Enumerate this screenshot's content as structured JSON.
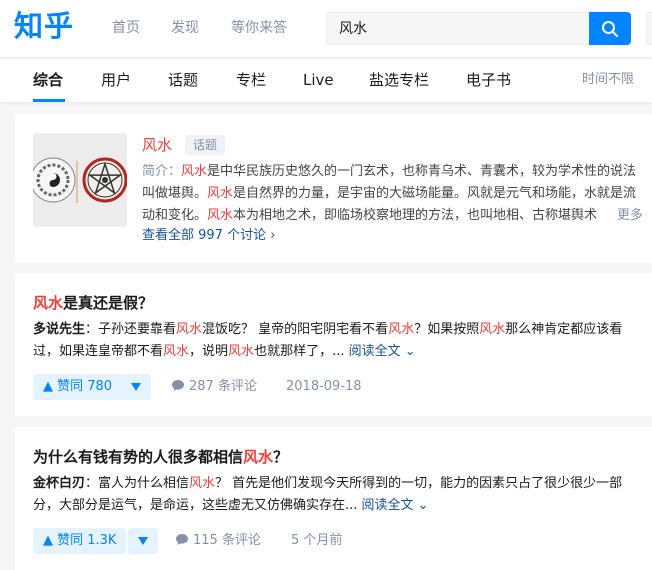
{
  "header": {
    "logo": "知乎",
    "nav": [
      "首页",
      "发现",
      "等你来答"
    ],
    "search": {
      "value": "风水"
    }
  },
  "tabs": {
    "items": [
      "综合",
      "用户",
      "话题",
      "专栏",
      "Live",
      "盐选专栏",
      "电子书"
    ],
    "active": "综合",
    "time_filter": "时间不限"
  },
  "topic_card": {
    "name": "风水",
    "badge": "话题",
    "desc_label": "简介：",
    "desc_parts": [
      {
        "t": "风水",
        "hl": true
      },
      {
        "t": "是中华民族历史悠久的一门玄术，也称青乌术、青囊术，较为学术性的说法叫做堪舆。",
        "hl": false
      },
      {
        "t": "风水",
        "hl": true
      },
      {
        "t": "是自然界的力量，是宇宙的大磁场能量。风就是元气和场能，水就是流动和变化。",
        "hl": false
      },
      {
        "t": "风水",
        "hl": true
      },
      {
        "t": "本为相地之术，即临场校察地理的方法，也叫地相、古称堪舆术",
        "hl": false
      }
    ],
    "more_label": "更多",
    "discuss_link": "查看全部 997 个讨论 ›"
  },
  "answers": [
    {
      "title_parts": [
        {
          "t": "风水",
          "hl": true
        },
        {
          "t": "是真还是假？",
          "hl": false
        }
      ],
      "author": "多说先生",
      "excerpt_parts": [
        {
          "t": "：子孙还要靠看",
          "hl": false
        },
        {
          "t": "风水",
          "hl": true
        },
        {
          "t": "混饭吃？ 皇帝的阳宅阴宅看不看",
          "hl": false
        },
        {
          "t": "风水",
          "hl": true
        },
        {
          "t": "？如果按照",
          "hl": false
        },
        {
          "t": "风水",
          "hl": true
        },
        {
          "t": "那么神肯定都应该看过，如果连皇帝都不看",
          "hl": false
        },
        {
          "t": "风水",
          "hl": true
        },
        {
          "t": "，说明",
          "hl": false
        },
        {
          "t": "风水",
          "hl": true
        },
        {
          "t": "也就那样了，... ",
          "hl": false
        }
      ],
      "read_more": "阅读全文 ⌄",
      "vote_label": "▲ 赞同 780",
      "comments": "287 条评论",
      "time": "2018-09-18"
    },
    {
      "title_parts": [
        {
          "t": "为什么有钱有势的人很多都相信",
          "hl": false
        },
        {
          "t": "风水",
          "hl": true
        },
        {
          "t": "？",
          "hl": false
        }
      ],
      "author": "金杯白刃",
      "excerpt_parts": [
        {
          "t": "：富人为什么相信",
          "hl": false
        },
        {
          "t": "风水",
          "hl": true
        },
        {
          "t": "？ 首先是他们发现今天所得到的一切，能力的因素只占了很少很少一部分，大部分是运气，是命运，这些虚无又仿佛确实存在... ",
          "hl": false
        }
      ],
      "read_more": "阅读全文 ⌄",
      "vote_label": "▲ 赞同 1.3K",
      "comments": "115 条评论",
      "time": "5 个月前"
    }
  ],
  "colors": {
    "brand": "#0084ff",
    "highlight": "#f1403c",
    "link": "#175199",
    "muted": "#8590a6"
  },
  "icons": [
    "search-icon",
    "comment-icon",
    "vote-down-icon",
    "chevron-down-icon"
  ]
}
